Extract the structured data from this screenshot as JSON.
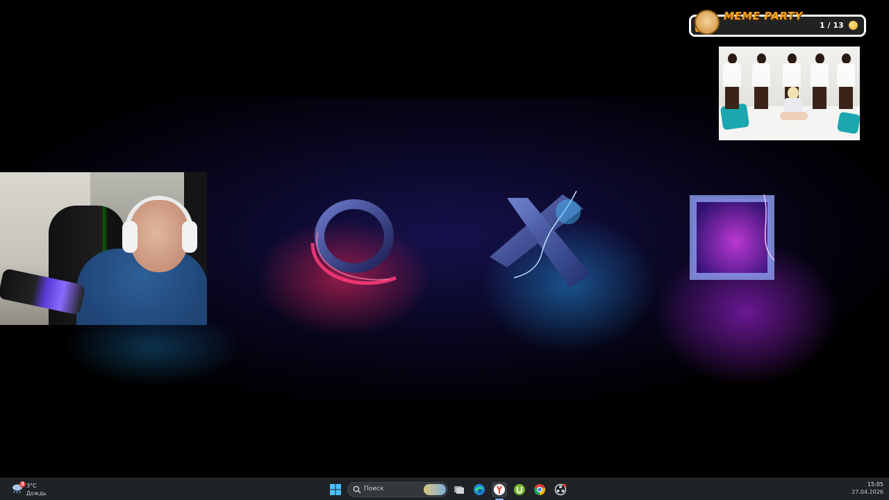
{
  "meme_party": {
    "title": "MEME PARTY",
    "count": "1 / 13",
    "progress_fraction": 0.08,
    "accent": "#f3a22e",
    "icon": "doge-icon"
  },
  "desktop": {
    "wallpaper_symbols": [
      "circle",
      "cross",
      "square"
    ],
    "colors": {
      "circle": "#ff3b7a",
      "cross": "#3fb6ff",
      "square": "#b63cff"
    }
  },
  "taskbar": {
    "weather": {
      "temperature": "3°C",
      "description": "Дождь",
      "badge": "3",
      "icon": "rain-cloud-icon"
    },
    "search_placeholder": "Поиск",
    "apps": [
      {
        "name": "start",
        "icon": "windows-icon"
      },
      {
        "name": "task-view",
        "icon": "task-view-icon"
      },
      {
        "name": "edge",
        "icon": "edge-icon"
      },
      {
        "name": "yandex-browser",
        "icon": "yandex-icon",
        "active": true
      },
      {
        "name": "utorrent",
        "icon": "torrent-icon"
      },
      {
        "name": "chrome",
        "icon": "chrome-icon"
      },
      {
        "name": "obs",
        "icon": "obs-icon"
      }
    ],
    "clock": {
      "time": "15:05",
      "date": "27.04.2026"
    }
  }
}
